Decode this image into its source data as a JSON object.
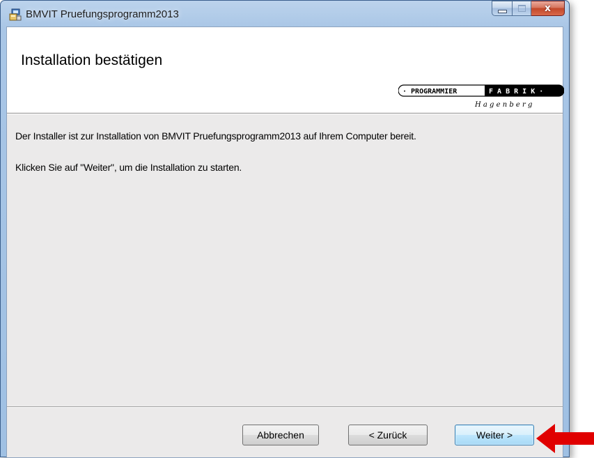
{
  "window": {
    "title": "BMVIT Pruefungsprogramm2013",
    "caption": {
      "minimize": "–",
      "maximize": "□",
      "close": "x"
    }
  },
  "header": {
    "title": "Installation bestätigen",
    "logo": {
      "line1_left": "· PROGRAMMIER",
      "line1_right": "F A B R I K ·",
      "line2": "H a g e n b e r g"
    }
  },
  "content": {
    "line1": "Der Installer ist zur Installation von BMVIT Pruefungsprogramm2013 auf Ihrem Computer bereit.",
    "line2": "Klicken Sie auf \"Weiter\", um die Installation zu starten."
  },
  "buttons": {
    "cancel": "Abbrechen",
    "back": "< Zurück",
    "next": "Weiter >"
  },
  "colors": {
    "arrow": "#e00000",
    "frame": "#a9c6e6",
    "client": "#ebeaea",
    "default_button_border": "#3c7fb1"
  },
  "icons": [
    "installer-icon",
    "minimize-icon",
    "maximize-icon",
    "close-icon",
    "red-arrow-icon"
  ]
}
